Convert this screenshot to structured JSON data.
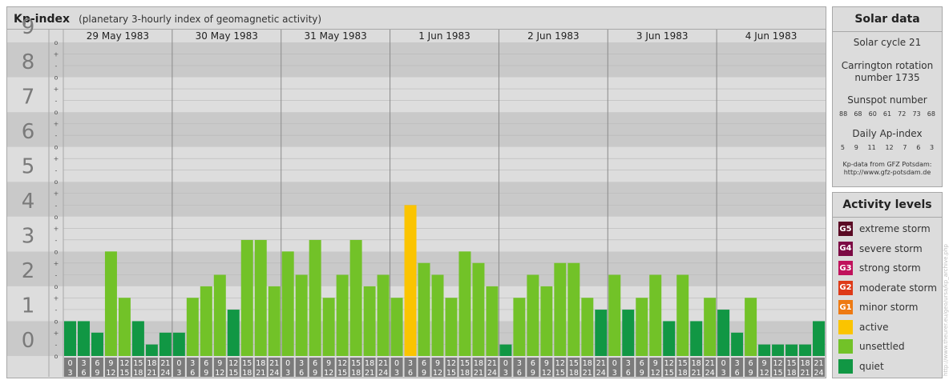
{
  "header": {
    "title": "Kp-index",
    "subtitle": "(planetary 3-hourly index of geomagnetic activity)"
  },
  "chart_data": {
    "type": "bar",
    "ylim": [
      0,
      9
    ],
    "y_ticks": [
      "0",
      "1",
      "2",
      "3",
      "4",
      "5",
      "6",
      "7",
      "8",
      "9"
    ],
    "sub_tick_labels": [
      "o",
      "-",
      "+",
      "o",
      "-",
      "+",
      "o",
      "-",
      "+",
      "o",
      "-",
      "+",
      "o",
      "-",
      "+",
      "o",
      "-",
      "+",
      "o",
      "-",
      "+",
      "o",
      "-",
      "+",
      "o",
      "-",
      "+",
      "o"
    ],
    "days": [
      "29 May 1983",
      "30 May 1983",
      "31 May 1983",
      "1 Jun 1983",
      "2 Jun 1983",
      "3 Jun 1983",
      "4 Jun 1983"
    ],
    "interval_top": [
      "0",
      "3",
      "6",
      "9",
      "12",
      "15",
      "18",
      "21"
    ],
    "interval_bottom": [
      "3",
      "6",
      "9",
      "12",
      "15",
      "18",
      "21",
      "24"
    ],
    "values": [
      1.0,
      1.0,
      0.67,
      3.0,
      1.67,
      1.0,
      0.33,
      0.67,
      0.67,
      1.67,
      2.0,
      2.33,
      1.33,
      3.33,
      3.33,
      2.0,
      3.0,
      2.33,
      3.33,
      1.67,
      2.33,
      3.33,
      2.0,
      2.33,
      1.67,
      4.33,
      2.67,
      2.33,
      1.67,
      3.0,
      2.67,
      2.0,
      0.33,
      1.67,
      2.33,
      2.0,
      2.67,
      2.67,
      1.67,
      1.33,
      2.33,
      1.33,
      1.67,
      2.33,
      1.0,
      2.33,
      1.0,
      1.67,
      1.33,
      0.67,
      1.67,
      0.33,
      0.33,
      0.33,
      0.33,
      1.0
    ],
    "level_colors": {
      "quiet": "#119744",
      "unsettled": "#72c228",
      "active": "#fbc400"
    }
  },
  "solar": {
    "title": "Solar data",
    "cycle": "Solar cycle 21",
    "carrington_1": "Carrington rotation",
    "carrington_2": "number 1735",
    "sunspot_label": "Sunspot number",
    "sunspot_values": [
      "88",
      "68",
      "60",
      "61",
      "72",
      "73",
      "68"
    ],
    "ap_label": "Daily Ap-index",
    "ap_values": [
      "5",
      "9",
      "11",
      "12",
      "7",
      "6",
      "3"
    ],
    "source_1": "Kp-data from GFZ Potsdam:",
    "source_2": "http://www.gfz-potsdam.de"
  },
  "activity": {
    "title": "Activity levels",
    "items": [
      {
        "badge": "G5",
        "label": "extreme storm",
        "color": "#5a0a24"
      },
      {
        "badge": "G4",
        "label": "severe storm",
        "color": "#7c0a44"
      },
      {
        "badge": "G3",
        "label": "strong storm",
        "color": "#c0125c"
      },
      {
        "badge": "G2",
        "label": "moderate storm",
        "color": "#de3a18"
      },
      {
        "badge": "G1",
        "label": "minor storm",
        "color": "#ee7a12"
      },
      {
        "badge": "",
        "label": "active",
        "color": "#fbc400"
      },
      {
        "badge": "",
        "label": "unsettled",
        "color": "#72c228"
      },
      {
        "badge": "",
        "label": "quiet",
        "color": "#119744"
      }
    ]
  },
  "credit": "http://www.theurer.eu/geo/ursa/kp_archive.php"
}
